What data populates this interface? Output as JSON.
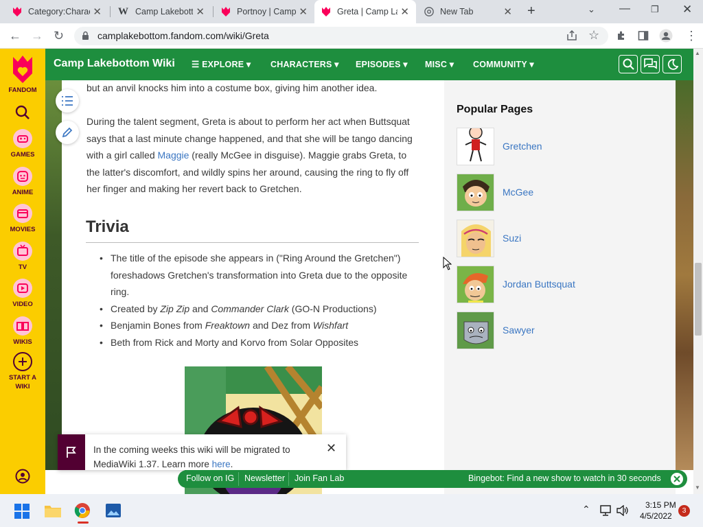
{
  "browser": {
    "tabs": [
      {
        "label": "Category:Charac",
        "icon": "fandom-icon"
      },
      {
        "label": "Camp Lakebotto",
        "icon": "wikipedia-icon"
      },
      {
        "label": "Portnoy | Camp",
        "icon": "fandom-icon"
      },
      {
        "label": "Greta | Camp La",
        "icon": "fandom-icon",
        "active": true
      },
      {
        "label": "New Tab",
        "icon": "chrome-icon"
      }
    ],
    "url": "camplakebottom.fandom.com/wiki/Greta"
  },
  "fandom_rail": {
    "brand": "FANDOM",
    "items": [
      "GAMES",
      "ANIME",
      "MOVIES",
      "TV",
      "VIDEO",
      "WIKIS"
    ],
    "start_wiki": [
      "START A",
      "WIKI"
    ]
  },
  "wiki_header": {
    "name": "Camp Lakebottom Wiki",
    "nav": [
      "EXPLORE",
      "CHARACTERS",
      "EPISODES",
      "MISC",
      "COMMUNITY"
    ]
  },
  "article": {
    "para1": "but an anvil knocks him into a costume box, giving him another idea.",
    "para2": {
      "before": "During the talent segment, Greta is about to perform her act when Buttsquat says that a last minute change happened, and that she will be tango dancing with a girl called ",
      "link": "Maggie",
      "after": " (really McGee in disguise). Maggie grabs Greta, to the latter's discomfort, and wildly spins her around, causing the ring to fly off her finger and making her revert back to Gretchen."
    },
    "trivia_heading": "Trivia",
    "trivia": {
      "t1": "The title of the episode she appears in (\"Ring Around the Gretchen\") foreshadows Gretchen's transformation into Greta due to the opposite ring.",
      "t2a": "Created by ",
      "t2b": "Zip Zip",
      "t2c": " and ",
      "t2d": "Commander Clark",
      "t2e": " (GO-N Productions)",
      "t3a": "Benjamin Bones from ",
      "t3b": "Freaktown",
      "t3c": " and Dez from ",
      "t3d": "Wishfart",
      "t4": "Beth from Rick and Morty and Korvo from Solar Opposites"
    }
  },
  "popular": {
    "title": "Popular Pages",
    "pages": [
      "Gretchen",
      "McGee",
      "Suzi",
      "Jordan Buttsquat",
      "Sawyer"
    ]
  },
  "notice": {
    "text": "In the coming weeks this wiki will be migrated to MediaWiki 1.37. Learn more ",
    "link": "here",
    "end": "."
  },
  "bottom_bar": {
    "buttons": [
      "Follow on IG",
      "Newsletter",
      "Join Fan Lab"
    ],
    "promo": "Bingebot: Find a new show to watch in 30 seconds"
  },
  "taskbar": {
    "time": "3:15 PM",
    "date": "4/5/2022",
    "badge": "3"
  },
  "colors": {
    "fandom_yellow": "#fbcd00",
    "wiki_green": "#1e8e3e",
    "fandom_plum": "#520032",
    "link": "#3a76c2"
  }
}
